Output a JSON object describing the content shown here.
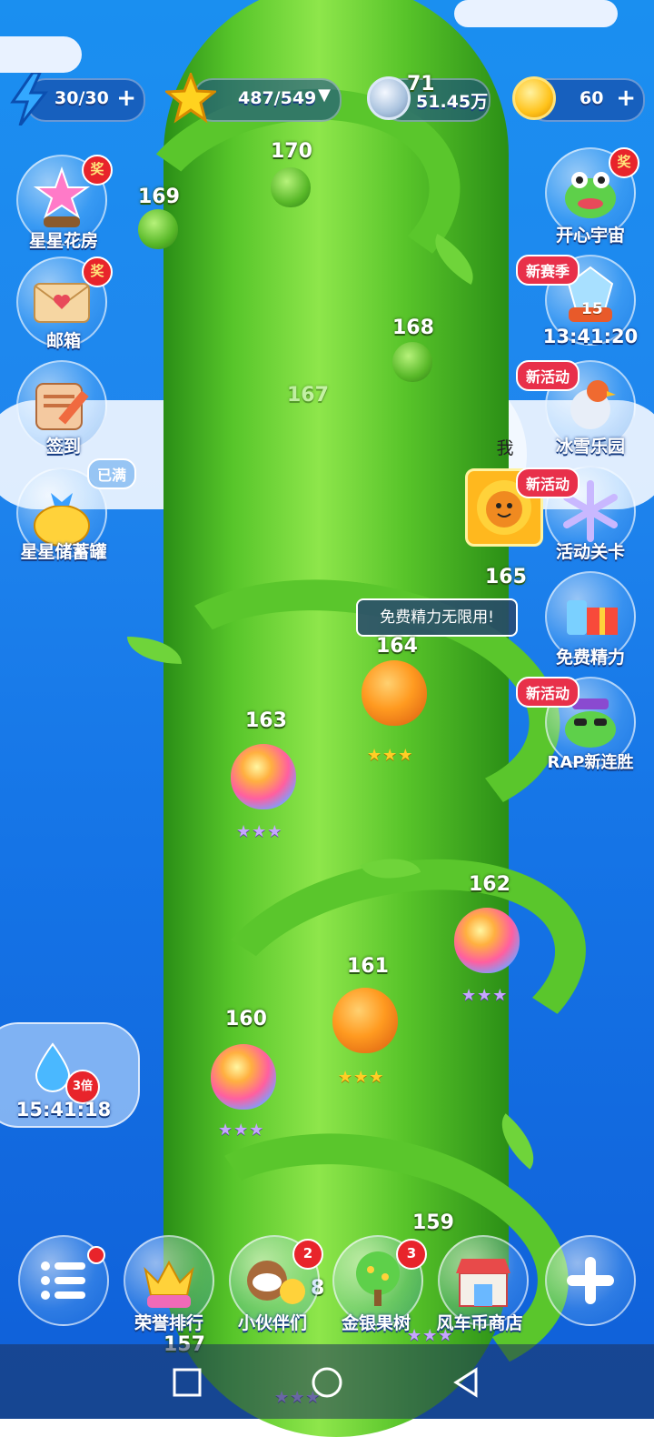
{
  "resources": {
    "energy": {
      "value": "30/30",
      "plus": "+",
      "icon": "lightning-icon"
    },
    "stars": {
      "value": "487/549",
      "dropdown": "▼",
      "icon": "star-icon"
    },
    "silver": {
      "value": "51.45万",
      "icon": "silver-coin-icon"
    },
    "gold": {
      "value": "60",
      "plus": "+",
      "icon": "gold-coin-icon"
    }
  },
  "left_buttons": {
    "flower_house": {
      "label": "星星花房",
      "badge": "奖"
    },
    "mailbox": {
      "label": "邮箱",
      "badge": "奖"
    },
    "checkin": {
      "label": "签到"
    },
    "piggy_bank": {
      "label": "星星储蓄罐",
      "badge": "已满"
    }
  },
  "right_buttons": {
    "happy_universe": {
      "label": "开心宇宙",
      "badge": "奖"
    },
    "new_season": {
      "tag": "新赛季",
      "number": "15",
      "timer": "13:41:20"
    },
    "ice_park": {
      "tag": "新活动",
      "label": "冰雪乐园"
    },
    "event_level": {
      "tag": "新活动",
      "label": "活动关卡"
    },
    "free_energy": {
      "label": "免费精力"
    },
    "rap_streak": {
      "tag": "新活动",
      "label": "RAP新连胜"
    }
  },
  "player": {
    "marker_label": "我",
    "tag": "新活动"
  },
  "tooltip": {
    "text": "免费精力无限用!"
  },
  "levels": [
    {
      "num": "170"
    },
    {
      "num": "169"
    },
    {
      "num": "168"
    },
    {
      "num": "167"
    },
    {
      "num": "165"
    },
    {
      "num": "164"
    },
    {
      "num": "163"
    },
    {
      "num": "162"
    },
    {
      "num": "161"
    },
    {
      "num": "160"
    },
    {
      "num": "159"
    },
    {
      "num": "157"
    },
    {
      "num": "71"
    },
    {
      "num": "8"
    }
  ],
  "stars_text": {
    "three": "★★★"
  },
  "water": {
    "multiplier": "3倍",
    "timer": "15:41:18"
  },
  "bottom_bar": {
    "menu": {
      "icon": "menu-list-icon"
    },
    "honor": {
      "label": "荣誉排行"
    },
    "partners": {
      "label": "小伙伴们",
      "badge": "2"
    },
    "fruit_tree": {
      "label": "金银果树",
      "badge": "3"
    },
    "shop": {
      "label": "风车币商店"
    },
    "add": {
      "icon": "plus-icon"
    }
  },
  "system_nav": {
    "icons": [
      "square-recent-icon",
      "circle-home-icon",
      "triangle-back-icon"
    ]
  }
}
